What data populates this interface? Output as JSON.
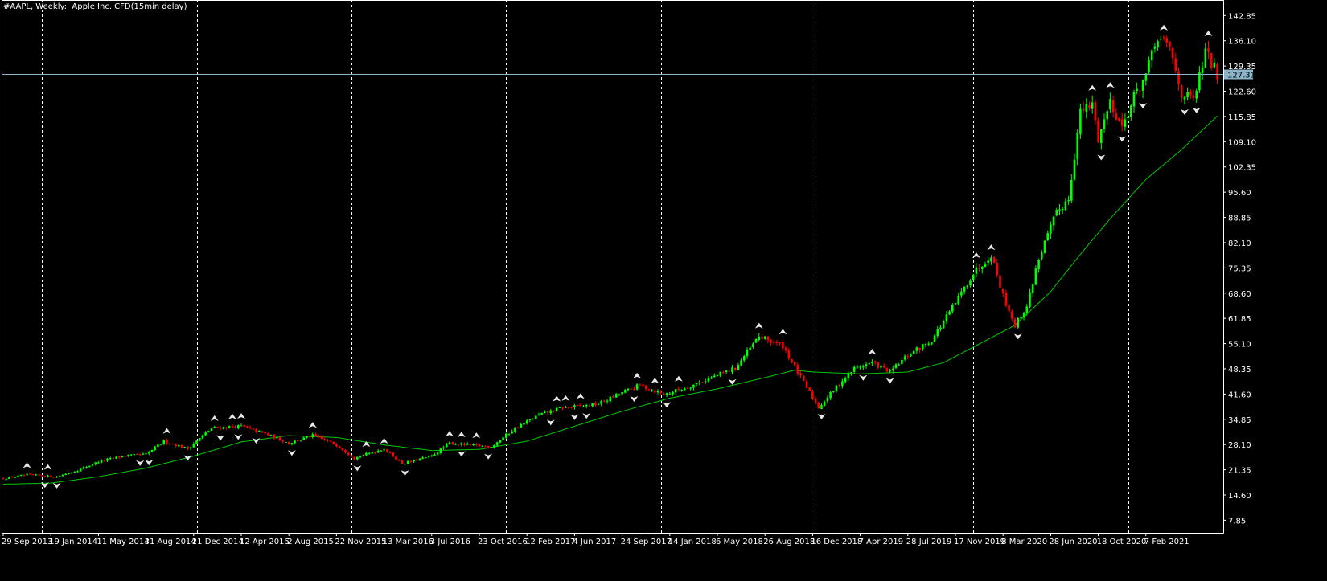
{
  "window": {
    "title": "#AAPL, Weekly:  Apple Inc. CFD(15min delay)"
  },
  "chart_data": {
    "type": "candlestick",
    "symbol": "#AAPL",
    "timeframe": "Weekly",
    "description": "Apple Inc. CFD(15min delay)",
    "colors": {
      "background": "#000000",
      "bull": "#00ff00",
      "bear": "#ff0000",
      "moving_average": "#00c800",
      "grid": "#ffffff",
      "price_line": "#8cb4c8",
      "fractal_marker": "#e8e8e8",
      "axis_text": "#ffffff"
    },
    "ylim": [
      4.5,
      147
    ],
    "y_ticks": [
      "142.85",
      "136.10",
      "129.35",
      "122.60",
      "115.85",
      "109.10",
      "102.35",
      "95.60",
      "88.85",
      "82.10",
      "75.35",
      "68.60",
      "61.85",
      "55.10",
      "48.35",
      "41.60",
      "34.85",
      "28.10",
      "21.35",
      "14.60",
      "7.85"
    ],
    "x_labels": [
      "29 Sep 2013",
      "19 Jan 2014",
      "11 May 2014",
      "31 Aug 2014",
      "21 Dec 2014",
      "12 Apr 2015",
      "2 Aug 2015",
      "22 Nov 2015",
      "13 Mar 2016",
      "3 Jul 2016",
      "23 Oct 2016",
      "12 Feb 2017",
      "4 Jun 2017",
      "24 Sep 2017",
      "14 Jan 2018",
      "6 May 2018",
      "26 Aug 2018",
      "16 Dec 2018",
      "7 Apr 2019",
      "28 Jul 2019",
      "17 Nov 2019",
      "8 Mar 2020",
      "28 Jun 2020",
      "18 Oct 2020",
      "7 Feb 2021"
    ],
    "x_label_index": [
      0,
      16,
      32,
      48,
      64,
      80,
      96,
      112,
      128,
      144,
      160,
      176,
      192,
      208,
      224,
      240,
      256,
      272,
      288,
      304,
      320,
      336,
      352,
      368,
      384
    ],
    "period_separators": [
      13,
      65,
      117,
      169,
      221,
      273,
      326,
      378
    ],
    "current_price": "127.31",
    "price_anchors": [
      {
        "i": 0,
        "p": 19.0
      },
      {
        "i": 8,
        "p": 20.0
      },
      {
        "i": 18,
        "p": 19.5
      },
      {
        "i": 26,
        "p": 21.5
      },
      {
        "i": 32,
        "p": 23.5
      },
      {
        "i": 40,
        "p": 25.0
      },
      {
        "i": 48,
        "p": 25.5
      },
      {
        "i": 54,
        "p": 29.0
      },
      {
        "i": 62,
        "p": 27.0
      },
      {
        "i": 70,
        "p": 32.5
      },
      {
        "i": 80,
        "p": 33.0
      },
      {
        "i": 88,
        "p": 31.0
      },
      {
        "i": 96,
        "p": 28.5
      },
      {
        "i": 104,
        "p": 30.5
      },
      {
        "i": 112,
        "p": 28.0
      },
      {
        "i": 118,
        "p": 24.5
      },
      {
        "i": 128,
        "p": 27.0
      },
      {
        "i": 134,
        "p": 23.0
      },
      {
        "i": 144,
        "p": 25.0
      },
      {
        "i": 150,
        "p": 28.5
      },
      {
        "i": 156,
        "p": 28.0
      },
      {
        "i": 164,
        "p": 27.5
      },
      {
        "i": 172,
        "p": 32.5
      },
      {
        "i": 180,
        "p": 36.0
      },
      {
        "i": 188,
        "p": 38.0
      },
      {
        "i": 196,
        "p": 38.5
      },
      {
        "i": 200,
        "p": 39.0
      },
      {
        "i": 208,
        "p": 42.0
      },
      {
        "i": 214,
        "p": 44.0
      },
      {
        "i": 222,
        "p": 41.5
      },
      {
        "i": 230,
        "p": 43.5
      },
      {
        "i": 238,
        "p": 46.0
      },
      {
        "i": 246,
        "p": 48.5
      },
      {
        "i": 254,
        "p": 57.0
      },
      {
        "i": 262,
        "p": 54.5
      },
      {
        "i": 268,
        "p": 46.0
      },
      {
        "i": 274,
        "p": 38.0
      },
      {
        "i": 280,
        "p": 43.5
      },
      {
        "i": 286,
        "p": 48.5
      },
      {
        "i": 292,
        "p": 50.0
      },
      {
        "i": 298,
        "p": 47.5
      },
      {
        "i": 304,
        "p": 52.0
      },
      {
        "i": 312,
        "p": 56.0
      },
      {
        "i": 320,
        "p": 66.0
      },
      {
        "i": 326,
        "p": 74.0
      },
      {
        "i": 332,
        "p": 79.0
      },
      {
        "i": 336,
        "p": 68.0
      },
      {
        "i": 340,
        "p": 60.0
      },
      {
        "i": 344,
        "p": 65.0
      },
      {
        "i": 348,
        "p": 78.0
      },
      {
        "i": 354,
        "p": 90.0
      },
      {
        "i": 358,
        "p": 94.0
      },
      {
        "i": 362,
        "p": 117.0
      },
      {
        "i": 366,
        "p": 119.0
      },
      {
        "i": 368,
        "p": 110.0
      },
      {
        "i": 372,
        "p": 120.0
      },
      {
        "i": 376,
        "p": 113.0
      },
      {
        "i": 380,
        "p": 121.0
      },
      {
        "i": 384,
        "p": 127.0
      },
      {
        "i": 388,
        "p": 137.0
      },
      {
        "i": 392,
        "p": 134.0
      },
      {
        "i": 396,
        "p": 122.0
      },
      {
        "i": 400,
        "p": 120.0
      },
      {
        "i": 404,
        "p": 133.0
      },
      {
        "i": 408,
        "p": 127.31
      }
    ],
    "moving_average": [
      {
        "i": 0,
        "p": 17.5
      },
      {
        "i": 16,
        "p": 17.8
      },
      {
        "i": 32,
        "p": 19.5
      },
      {
        "i": 48,
        "p": 21.8
      },
      {
        "i": 64,
        "p": 25.0
      },
      {
        "i": 80,
        "p": 28.8
      },
      {
        "i": 96,
        "p": 30.5
      },
      {
        "i": 112,
        "p": 30.0
      },
      {
        "i": 128,
        "p": 28.0
      },
      {
        "i": 144,
        "p": 26.5
      },
      {
        "i": 160,
        "p": 26.8
      },
      {
        "i": 176,
        "p": 29.0
      },
      {
        "i": 192,
        "p": 33.0
      },
      {
        "i": 208,
        "p": 37.0
      },
      {
        "i": 224,
        "p": 40.5
      },
      {
        "i": 240,
        "p": 43.0
      },
      {
        "i": 256,
        "p": 46.0
      },
      {
        "i": 266,
        "p": 48.0
      },
      {
        "i": 272,
        "p": 47.5
      },
      {
        "i": 288,
        "p": 47.0
      },
      {
        "i": 304,
        "p": 47.5
      },
      {
        "i": 316,
        "p": 50.0
      },
      {
        "i": 328,
        "p": 55.0
      },
      {
        "i": 340,
        "p": 60.0
      },
      {
        "i": 352,
        "p": 69.0
      },
      {
        "i": 362,
        "p": 79.0
      },
      {
        "i": 372,
        "p": 88.5
      },
      {
        "i": 384,
        "p": 99.0
      },
      {
        "i": 396,
        "p": 107.0
      },
      {
        "i": 408,
        "p": 116.0
      }
    ]
  }
}
